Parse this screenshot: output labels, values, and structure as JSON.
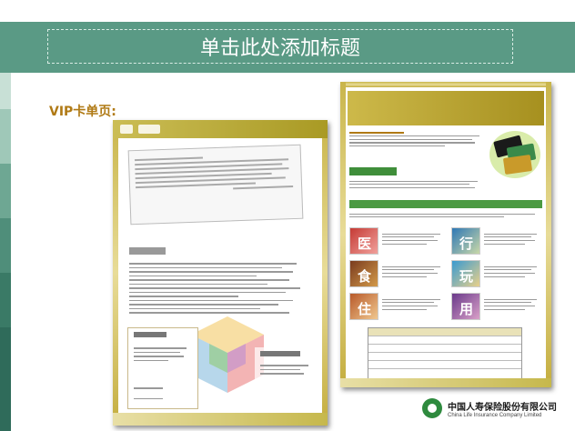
{
  "slide": {
    "title_placeholder": "单击此处添加标题",
    "section_label": "VIP卡单页:",
    "colors": {
      "title_band": "#5a9a85",
      "section_label": "#b07a15",
      "gold": "#c9b54a",
      "stripe_colors": [
        "#ffffff",
        "#9fc8b8",
        "#6ea793",
        "#4f8e7a",
        "#2f6b5a"
      ]
    }
  },
  "doc_left": {
    "icons": [
      "company-logo-icon",
      "brand-mark-icon",
      "colored-cube-graphic"
    ]
  },
  "doc_right": {
    "thumb_chars": [
      "医",
      "行",
      "食",
      "玩",
      "住",
      "用"
    ]
  },
  "footer_logo": {
    "chinese": "中国人寿保险股份有限公司",
    "english": "China Life Insurance Company Limited"
  }
}
